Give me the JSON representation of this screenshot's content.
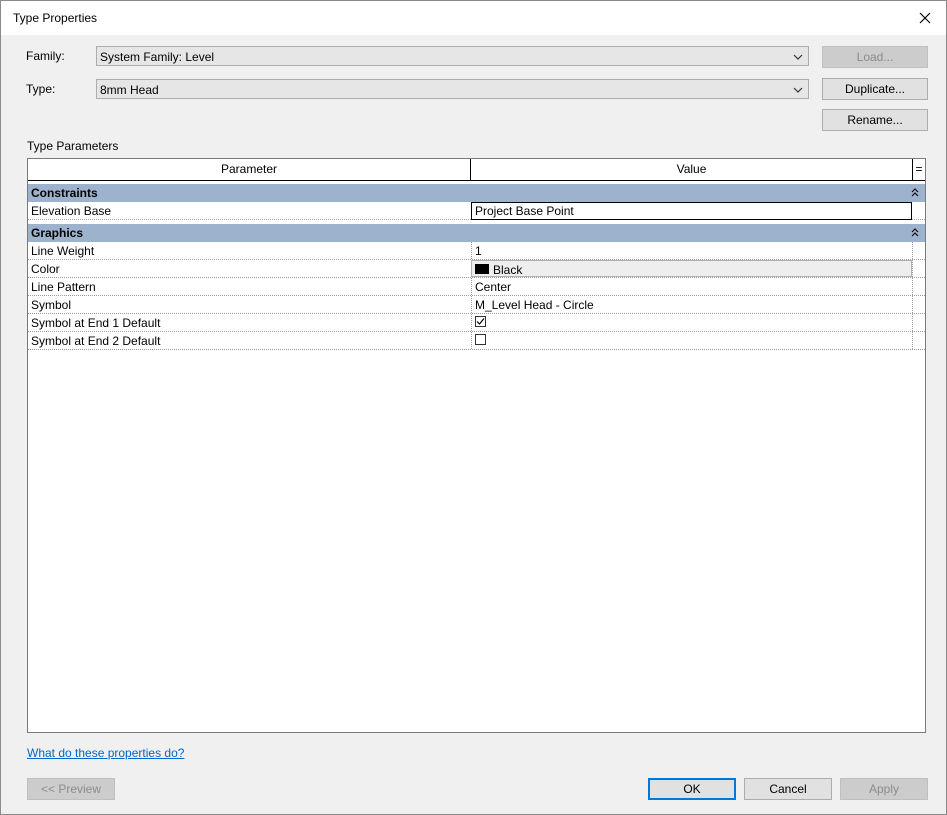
{
  "window": {
    "title": "Type Properties"
  },
  "family": {
    "label": "Family:",
    "value": "System Family: Level"
  },
  "type": {
    "label": "Type:",
    "value": "8mm Head"
  },
  "buttons": {
    "load": "Load...",
    "duplicate": "Duplicate...",
    "rename": "Rename...",
    "preview": "<< Preview",
    "ok": "OK",
    "cancel": "Cancel",
    "apply": "Apply"
  },
  "section_title": "Type Parameters",
  "table": {
    "col_parameter": "Parameter",
    "col_value": "Value",
    "col_sort_glyph": "=",
    "categories": [
      {
        "name": "Constraints",
        "rows": [
          {
            "param": "Elevation Base",
            "value": "Project Base Point"
          }
        ]
      },
      {
        "name": "Graphics",
        "rows": [
          {
            "param": "Line Weight",
            "value": "1"
          },
          {
            "param": "Color",
            "value": "Black",
            "swatch": "#000000"
          },
          {
            "param": "Line Pattern",
            "value": "Center"
          },
          {
            "param": "Symbol",
            "value": "M_Level Head - Circle"
          },
          {
            "param": "Symbol at End 1 Default",
            "checked": true
          },
          {
            "param": "Symbol at End 2 Default",
            "checked": false
          }
        ]
      }
    ]
  },
  "help_link": "What do these properties do?",
  "colors": {
    "category_bg": "#9db3cd",
    "link": "#0066cc",
    "focus": "#0078d7"
  }
}
